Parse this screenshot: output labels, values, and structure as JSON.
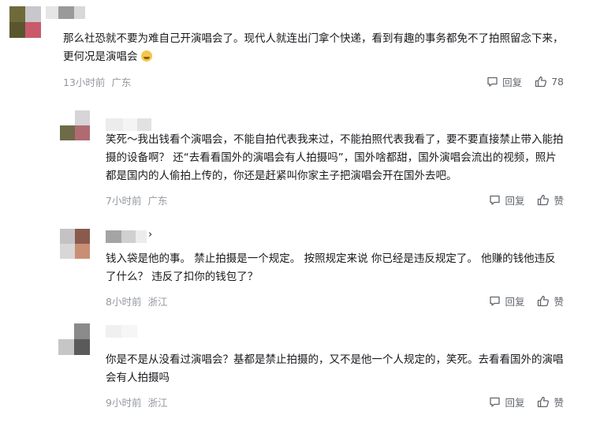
{
  "comments": [
    {
      "text": "那么社恐就不要为难自己开演唱会了。现代人就连出门拿个快递，看到有趣的事务都免不了拍照留念下来，更何况是演唱会",
      "emoji": "grin-face-emoji",
      "time": "13小时前",
      "location": "广东",
      "reply_label": "回复",
      "like_label": "78"
    },
    {
      "text": "笑死～我出钱看个演唱会，不能自拍代表我来过，不能拍照代表我看了，要不要直接禁止带入能拍摄的设备啊？ 还“去看看国外的演唱会有人拍摄吗”，国外啥都甜，国外演唱会流出的视频，照片都是国内的人偷拍上传的，你还是赶紧叫你家主子把演唱会开在国外去吧。",
      "time": "7小时前",
      "location": "广东",
      "reply_label": "回复",
      "like_label": "赞"
    },
    {
      "text": "钱入袋是他的事。 禁止拍摄是一个规定。 按照规定来说 你已经是违反规定了。 他赚的钱他违反了什么？ 违反了扣你的钱包了？",
      "time": "8小时前",
      "location": "浙江",
      "reply_label": "回复",
      "like_label": "赞",
      "name_suffix": "›"
    },
    {
      "text": "你是不是从没看过演唱会？基都是禁止拍摄的，又不是他一个人规定的，笑死。去看看国外的演唱会有人拍摄吗",
      "time": "9小时前",
      "location": "浙江",
      "reply_label": "回复",
      "like_label": "赞"
    }
  ],
  "colors": {
    "text": "#18191c",
    "meta": "#9499a0",
    "action": "#61666d"
  }
}
